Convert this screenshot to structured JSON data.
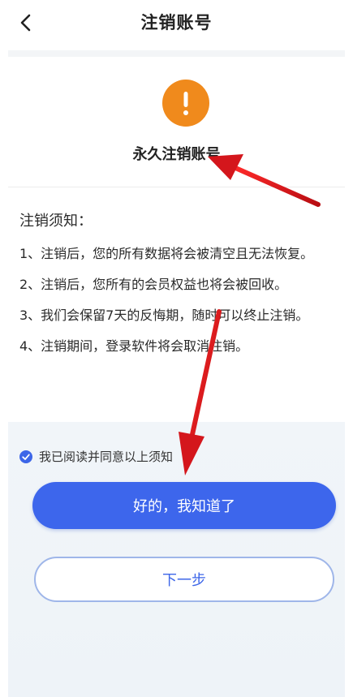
{
  "header": {
    "title": "注销账号",
    "back_icon": "chevron-left-icon"
  },
  "warning": {
    "icon": "exclamation-icon",
    "icon_color": "#f08a1c",
    "title": "永久注销账号"
  },
  "notice": {
    "title": "注销须知：",
    "items": [
      "1、注销后，您的所有数据将会被清空且无法恢复。",
      "2、注销后，您所有的会员权益也将会被回收。",
      "3、我们会保留7天的反悔期，随时可以终止注销。",
      "4、注销期间，登录软件将会取消注销。"
    ]
  },
  "agreement": {
    "label": "我已阅读并同意以上须知",
    "checked": true,
    "check_icon": "check-circle-icon"
  },
  "buttons": {
    "primary_label": "好的，我知道了",
    "secondary_label": "下一步"
  },
  "colors": {
    "accent": "#3d66ec",
    "warning": "#f08a1c",
    "annotation_arrow": "#d4161c"
  }
}
